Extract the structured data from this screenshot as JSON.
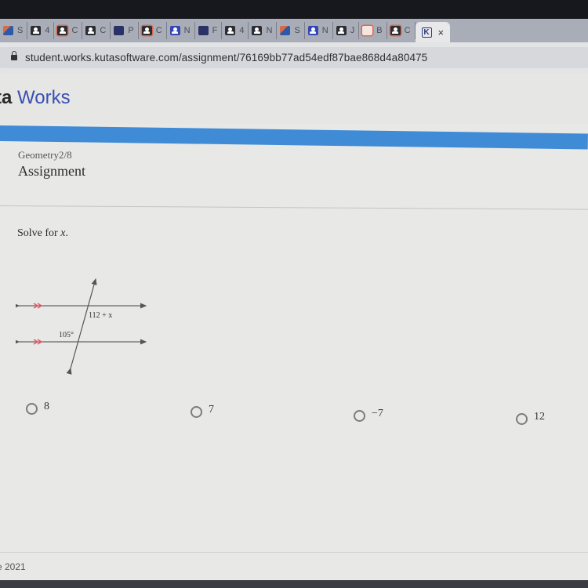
{
  "browser": {
    "tabs": [
      {
        "favicon": "multicolor-app-icon",
        "label": "S",
        "style": "multi"
      },
      {
        "favicon": "classroom-icon",
        "label": "4",
        "style": "dark"
      },
      {
        "favicon": "classroom-icon",
        "label": "C",
        "style": "orange"
      },
      {
        "favicon": "classroom-icon",
        "label": "C",
        "style": "dark"
      },
      {
        "favicon": "document-icon",
        "label": "P",
        "style": "navy"
      },
      {
        "favicon": "classroom-icon",
        "label": "C",
        "style": "orange"
      },
      {
        "favicon": "classroom-icon",
        "label": "N",
        "style": "blue"
      },
      {
        "favicon": "grid-icon",
        "label": "F",
        "style": "navy"
      },
      {
        "favicon": "classroom-icon",
        "label": "4",
        "style": "dark"
      },
      {
        "favicon": "classroom-icon",
        "label": "N",
        "style": "dark"
      },
      {
        "favicon": "multicolor-app-icon",
        "label": "S",
        "style": "multi"
      },
      {
        "favicon": "classroom-icon",
        "label": "N",
        "style": "blue"
      },
      {
        "favicon": "classroom-icon",
        "label": "J",
        "style": "dark"
      },
      {
        "favicon": "slides-icon",
        "label": "B",
        "style": "red"
      },
      {
        "favicon": "classroom-icon",
        "label": "C",
        "style": "orange"
      }
    ],
    "active_tab": {
      "favicon_glyph": "K",
      "close_glyph": "×"
    },
    "url": "student.works.kutasoftware.com/assignment/76169bb77ad54edf87bae868d4a80475"
  },
  "site": {
    "brand_prefix": "ta",
    "brand_suffix": "Works",
    "accent_color": "#3f8bd6"
  },
  "assignment": {
    "course": "Geometry2/8",
    "title": "Assignment"
  },
  "question": {
    "prompt_text": "Solve for ",
    "prompt_variable": "x",
    "prompt_end": ".",
    "diagram": {
      "angle_top_label": "112 + x",
      "angle_bottom_label": "105°",
      "parallel_marker_color": "#e05a6a"
    },
    "choices": [
      {
        "label": "8",
        "selected": false
      },
      {
        "label": "7",
        "selected": false
      },
      {
        "label": "−7",
        "selected": false
      },
      {
        "label": "12",
        "selected": false
      }
    ]
  },
  "footer": {
    "text": "e 2021"
  }
}
